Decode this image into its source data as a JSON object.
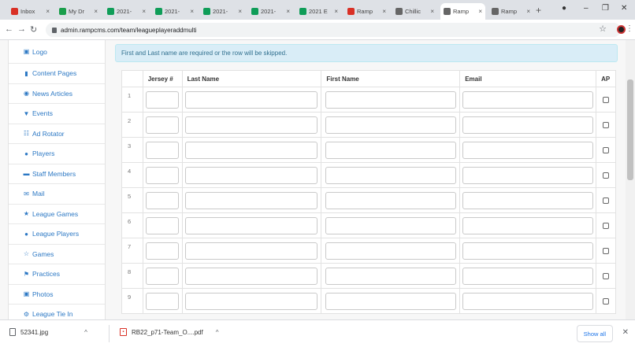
{
  "browser": {
    "tabs": [
      {
        "label": "Inbox",
        "color": "#d93025",
        "icon": "gmail-icon"
      },
      {
        "label": "My Dr",
        "color": "#1a9e4b",
        "icon": "drive-icon"
      },
      {
        "label": "2021-",
        "color": "#0f9d58",
        "icon": "sheets-icon"
      },
      {
        "label": "2021-",
        "color": "#0f9d58",
        "icon": "sheets-icon"
      },
      {
        "label": "2021-",
        "color": "#0f9d58",
        "icon": "sheets-icon"
      },
      {
        "label": "2021-",
        "color": "#0f9d58",
        "icon": "sheets-icon"
      },
      {
        "label": "2021 E",
        "color": "#0f9d58",
        "icon": "sheets-icon"
      },
      {
        "label": "Ramp",
        "color": "#d93025",
        "icon": "gmail-icon"
      },
      {
        "label": "Chillic",
        "color": "#666666",
        "icon": "site-icon"
      },
      {
        "label": "Ramp",
        "color": "#666666",
        "icon": "site-icon"
      },
      {
        "label": "Ramp",
        "color": "#666666",
        "icon": "site-icon"
      }
    ],
    "active_tab_index": 9,
    "url": "admin.rampcms.com/team/leagueplayeraddmulti"
  },
  "sidebar": {
    "items": [
      {
        "label": "Logo",
        "icon": "camera-icon",
        "glyph": "▣"
      },
      {
        "label": "Content Pages",
        "icon": "file-icon",
        "glyph": "▮"
      },
      {
        "label": "News Articles",
        "icon": "globe-icon",
        "glyph": "◉"
      },
      {
        "label": "Events",
        "icon": "filter-icon",
        "glyph": "▼"
      },
      {
        "label": "Ad Rotator",
        "icon": "grid-icon",
        "glyph": "☷"
      },
      {
        "label": "Players",
        "icon": "user-icon",
        "glyph": "●"
      },
      {
        "label": "Staff Members",
        "icon": "briefcase-icon",
        "glyph": "▬"
      },
      {
        "label": "Mail",
        "icon": "envelope-icon",
        "glyph": "✉"
      },
      {
        "label": "League Games",
        "icon": "star-icon",
        "glyph": "★"
      },
      {
        "label": "League Players",
        "icon": "user-icon",
        "glyph": "●"
      },
      {
        "label": "Games",
        "icon": "star-outline-icon",
        "glyph": "☆"
      },
      {
        "label": "Practices",
        "icon": "flag-icon",
        "glyph": "⚑"
      },
      {
        "label": "Photos",
        "icon": "camera-icon",
        "glyph": "▣"
      },
      {
        "label": "League Tie In",
        "icon": "gear-icon",
        "glyph": "⚙"
      }
    ]
  },
  "main": {
    "info_message": "First and Last name are required or the row will be skipped.",
    "table": {
      "headers": [
        "Jersey #",
        "Last Name",
        "First Name",
        "Email",
        "AP"
      ],
      "rows": [
        "1",
        "2",
        "3",
        "4",
        "5",
        "6",
        "7",
        "8",
        "9"
      ]
    }
  },
  "downloads": {
    "items": [
      {
        "name": "52341.jpg",
        "icon": "image-file-icon"
      },
      {
        "name": "RB22_p71-Team_O....pdf",
        "icon": "pdf-icon"
      }
    ],
    "show_all": "Show all"
  },
  "colors": {
    "link": "#2c78c4",
    "info_bg": "#d9edf7",
    "info_text": "#31708f"
  }
}
